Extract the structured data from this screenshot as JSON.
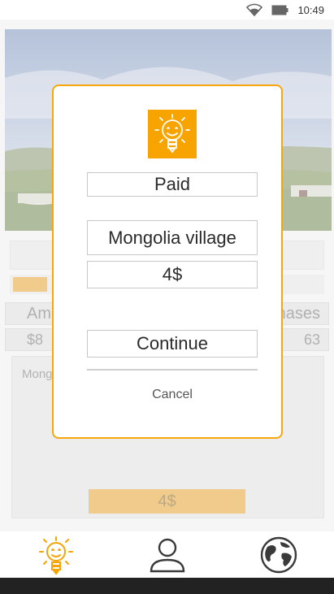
{
  "status_bar": {
    "time": "10:49",
    "wifi_icon": "wifi-icon",
    "battery_icon": "battery-icon"
  },
  "background": {
    "hero_image": "landscape-yurts-image",
    "labels": {
      "left": "Amo",
      "right": "nases"
    },
    "values": {
      "left": "$8",
      "right": "63"
    },
    "description": "Mong...                                    ed by Russi...                                   uth and W... count...",
    "buy_label": "4$",
    "progress_fraction": 0.11
  },
  "dialog": {
    "logo_icon": "lightbulb-smile-icon",
    "status": "Paid",
    "name": "Mongolia village",
    "price": "4$",
    "continue_label": "Continue",
    "cancel_label": "Cancel"
  },
  "tabs": [
    {
      "name": "tab-home",
      "icon": "lightbulb-smile-icon",
      "active": true
    },
    {
      "name": "tab-profile",
      "icon": "person-icon",
      "active": false
    },
    {
      "name": "tab-world",
      "icon": "globe-icon",
      "active": false
    }
  ],
  "colors": {
    "accent": "#f7a300",
    "accent_border": "#f7a70c",
    "buy_button": "#e8b04d"
  }
}
